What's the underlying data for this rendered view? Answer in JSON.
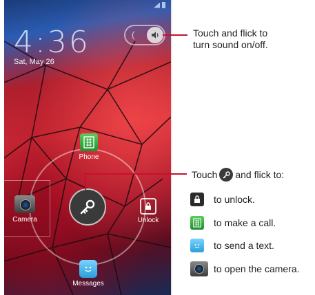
{
  "lockscreen": {
    "time": "4:36",
    "date": "Sat, May 26",
    "targets": {
      "phone": "Phone",
      "unlock": "Unlock",
      "camera": "Camera",
      "messages": "Messages"
    }
  },
  "callouts": {
    "sound_line1": "Touch and flick to",
    "sound_line2": "turn sound on/off.",
    "key_prefix": "Touch",
    "key_suffix": "and flick to:",
    "items": {
      "unlock": "to unlock.",
      "call": "to make a call.",
      "text": "to send a text.",
      "camera": "to open the camera."
    }
  },
  "colors": {
    "accent_line": "#c8102e",
    "key_handle": "#3a3a3a"
  },
  "icons": [
    "signal-icon",
    "battery-icon",
    "speaker-icon",
    "key-icon",
    "lock-icon",
    "phone-icon",
    "messages-icon",
    "camera-icon"
  ]
}
